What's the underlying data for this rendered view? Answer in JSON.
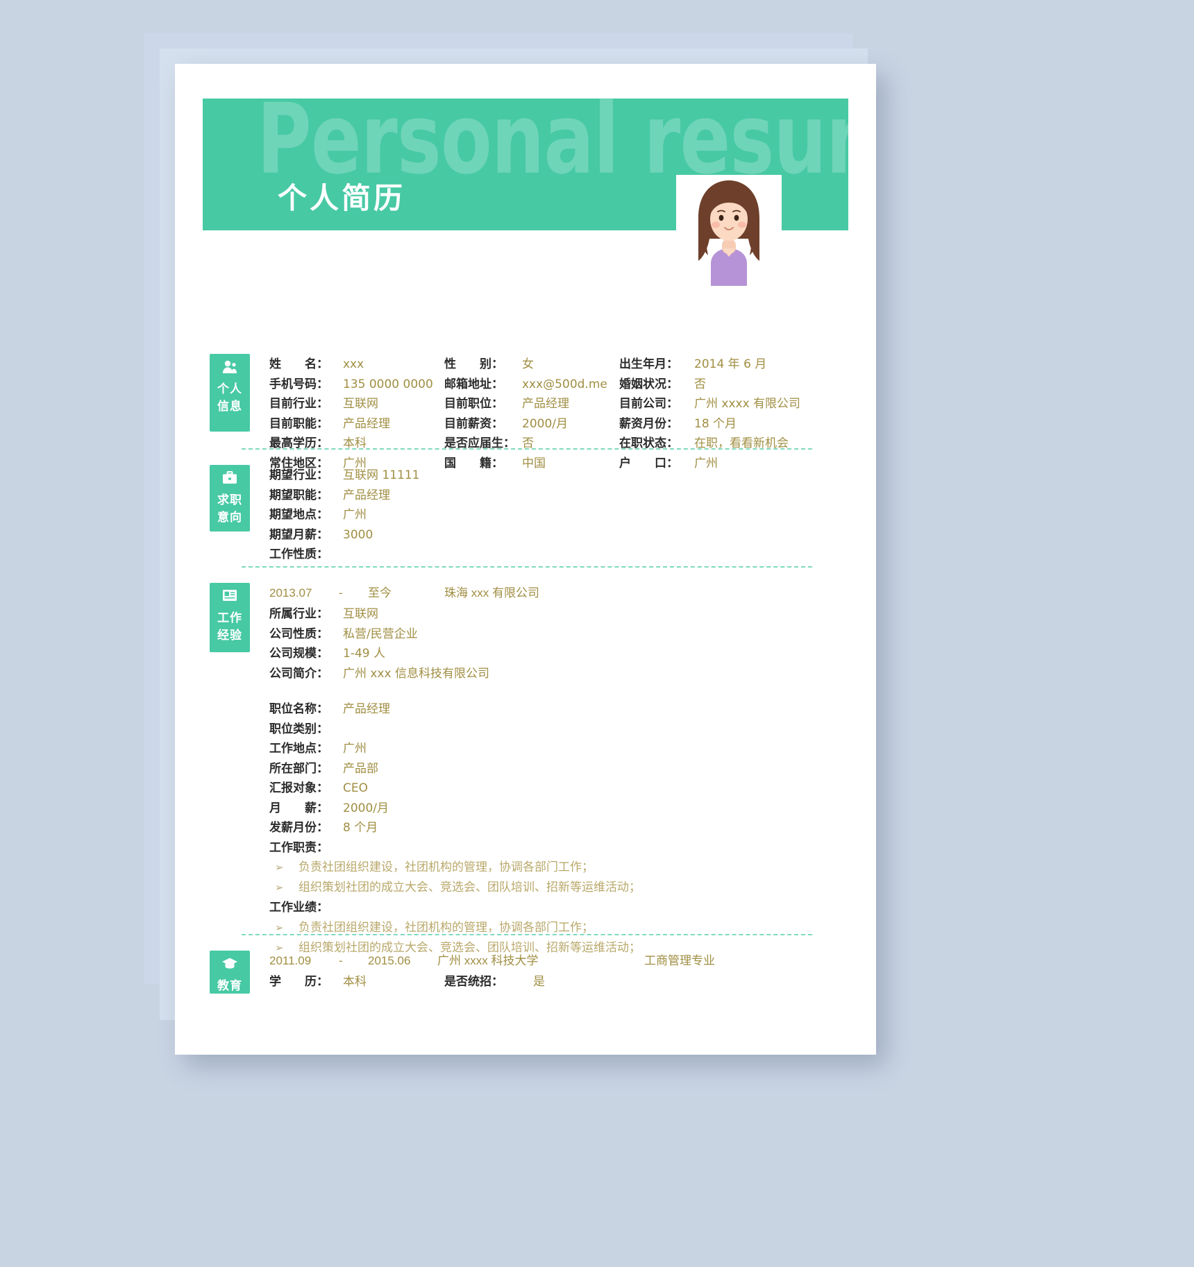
{
  "header": {
    "ghost_title": "Personal resume",
    "title": "个人简历"
  },
  "sections": {
    "personal": {
      "badge_line1": "个人",
      "badge_line2": "信息",
      "icon": "person-icon",
      "rows": [
        [
          {
            "label": "姓　　名：",
            "value": "xxx"
          },
          {
            "label": "性　　别：",
            "value": "女"
          },
          {
            "label": "出生年月：",
            "value": "2014 年 6 月"
          }
        ],
        [
          {
            "label": "手机号码：",
            "value": "135 0000 0000"
          },
          {
            "label": "邮箱地址：",
            "value": "xxx@500d.me"
          },
          {
            "label": "婚姻状况：",
            "value": "否"
          }
        ],
        [
          {
            "label": "目前行业：",
            "value": "互联网"
          },
          {
            "label": "目前职位：",
            "value": "产品经理"
          },
          {
            "label": "目前公司：",
            "value": "广州 xxxx 有限公司"
          }
        ],
        [
          {
            "label": "目前职能：",
            "value": "产品经理"
          },
          {
            "label": "目前薪资：",
            "value": "2000/月"
          },
          {
            "label": "薪资月份：",
            "value": "18 个月"
          }
        ],
        [
          {
            "label": "最高学历：",
            "value": "本科"
          },
          {
            "label": "是否应届生：",
            "value": "否"
          },
          {
            "label": "在职状态：",
            "value": "在职，看看新机会"
          }
        ],
        [
          {
            "label": "常住地区：",
            "value": "广州"
          },
          {
            "label": "国　　籍：",
            "value": "中国"
          },
          {
            "label": "户　　口：",
            "value": "广州"
          }
        ]
      ]
    },
    "intention": {
      "badge_line1": "求职",
      "badge_line2": "意向",
      "icon": "briefcase-icon",
      "rows": [
        {
          "label": "期望行业：",
          "value": "互联网 11111"
        },
        {
          "label": "期望职能：",
          "value": "产品经理"
        },
        {
          "label": "期望地点：",
          "value": "广州"
        },
        {
          "label": "期望月薪：",
          "value": "3000"
        },
        {
          "label": "工作性质：",
          "value": ""
        }
      ]
    },
    "work": {
      "badge_line1": "工作",
      "badge_line2": "经验",
      "icon": "id-card-icon",
      "head": {
        "date_from": "2013.07",
        "dash": "-",
        "date_to": "至今",
        "company": "珠海 xxx 有限公司"
      },
      "company_rows": [
        {
          "label": "所属行业：",
          "value": "互联网"
        },
        {
          "label": "公司性质：",
          "value": "私营/民营企业"
        },
        {
          "label": "公司规模：",
          "value": "1-49 人"
        },
        {
          "label": "公司简介：",
          "value": "广州 xxx 信息科技有限公司"
        }
      ],
      "position_rows": [
        {
          "label": "职位名称：",
          "value": "产品经理"
        },
        {
          "label": "职位类别：",
          "value": ""
        },
        {
          "label": "工作地点：",
          "value": "广州"
        },
        {
          "label": "所在部门：",
          "value": "产品部"
        },
        {
          "label": "汇报对象：",
          "value": "CEO"
        },
        {
          "label": "月　　薪：",
          "value": "2000/月"
        },
        {
          "label": "发薪月份：",
          "value": "8 个月"
        }
      ],
      "duties_label": "工作职责：",
      "duties": [
        "负责社团组织建设，社团机构的管理，协调各部门工作；",
        "组织策划社团的成立大会、竞选会、团队培训、招新等运维活动；"
      ],
      "achievements_label": "工作业绩：",
      "achievements": [
        "负责社团组织建设，社团机构的管理，协调各部门工作；",
        "组织策划社团的成立大会、竞选会、团队培训、招新等运维活动；"
      ],
      "bullet_glyph": "➢"
    },
    "education": {
      "badge_line1": "教育",
      "icon": "graduation-cap-icon",
      "head": {
        "date_from": "2011.09",
        "dash": "-",
        "date_to": "2015.06",
        "school": "广州 xxxx 科技大学",
        "major": "工商管理专业"
      },
      "row2": {
        "label1": "学　　历：",
        "value1": "本科",
        "label2": "是否统招：",
        "value2": "是"
      }
    }
  },
  "colors": {
    "accent": "#47c9a4",
    "value_text": "#a08e42",
    "label_text": "#2b2b2b",
    "page_bg": "#c9d4e3",
    "divider": "#7fd9c0"
  }
}
